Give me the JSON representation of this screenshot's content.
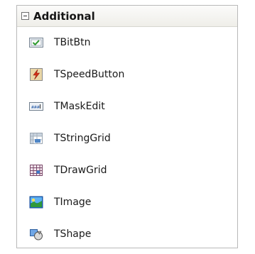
{
  "section": {
    "title": "Additional",
    "collapse_icon": "minus-collapse-icon"
  },
  "items": [
    {
      "label": "TBitBtn",
      "icon": "bitbtn-check-icon"
    },
    {
      "label": "TSpeedButton",
      "icon": "speedbutton-lightning-icon"
    },
    {
      "label": "TMaskEdit",
      "icon": "maskedit-icon"
    },
    {
      "label": "TStringGrid",
      "icon": "stringgrid-icon"
    },
    {
      "label": "TDrawGrid",
      "icon": "drawgrid-icon"
    },
    {
      "label": "TImage",
      "icon": "image-icon"
    },
    {
      "label": "TShape",
      "icon": "shape-icon"
    }
  ]
}
